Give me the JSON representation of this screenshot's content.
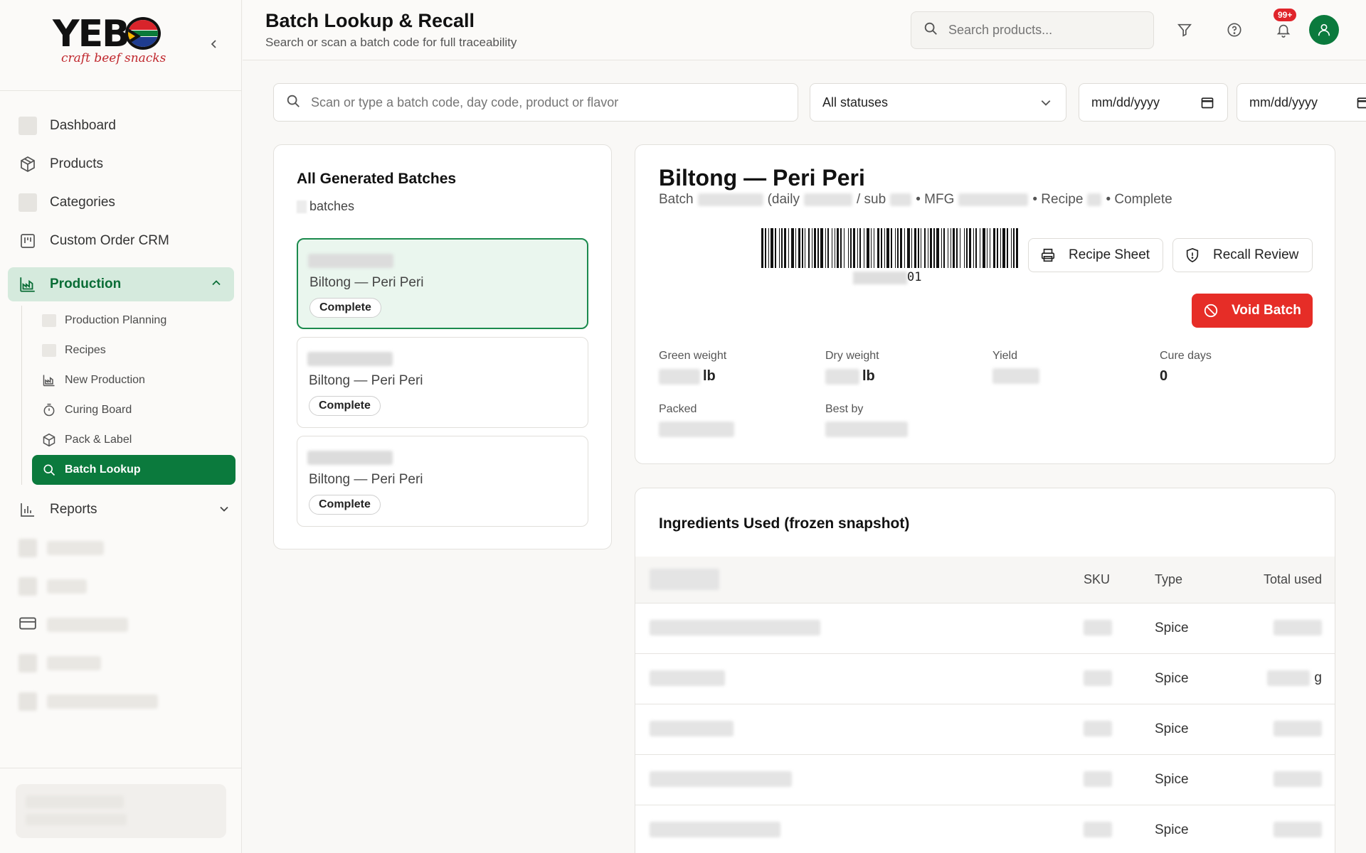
{
  "brand": {
    "logo_text": "YEBO",
    "tagline": "craft beef snacks"
  },
  "nav": {
    "items": [
      {
        "label": "Dashboard",
        "icon": "placeholder-icon"
      },
      {
        "label": "Products",
        "icon": "box-icon"
      },
      {
        "label": "Categories",
        "icon": "placeholder-icon"
      },
      {
        "label": "Custom Order CRM",
        "icon": "kanban-icon"
      }
    ],
    "production": {
      "label": "Production",
      "icon": "factory-icon",
      "expanded": true,
      "sub_items": [
        {
          "label": "Production Planning",
          "icon": "placeholder-icon"
        },
        {
          "label": "Recipes",
          "icon": "placeholder-icon"
        },
        {
          "label": "New Production",
          "icon": "factory-icon"
        },
        {
          "label": "Curing Board",
          "icon": "timer-icon"
        },
        {
          "label": "Pack & Label",
          "icon": "package-icon"
        },
        {
          "label": "Batch Lookup",
          "icon": "search-icon",
          "active": true
        }
      ]
    },
    "reports": {
      "label": "Reports",
      "icon": "bar-chart-icon"
    }
  },
  "header": {
    "title": "Batch Lookup & Recall",
    "subtitle": "Search or scan a batch code for full traceability",
    "search_placeholder": "Search products...",
    "notification_badge": "99+"
  },
  "filters": {
    "search_placeholder": "Scan or type a batch code, day code, product or flavor",
    "status_selected": "All statuses",
    "date_from_placeholder": "mm/dd/yyyy",
    "date_to_placeholder": "mm/dd/yyyy"
  },
  "batch_list": {
    "title": "All Generated Batches",
    "count_suffix": "batches",
    "items": [
      {
        "name": "Biltong — Peri Peri",
        "status": "Complete",
        "selected": true
      },
      {
        "name": "Biltong — Peri Peri",
        "status": "Complete",
        "selected": false
      },
      {
        "name": "Biltong — Peri Peri",
        "status": "Complete",
        "selected": false
      }
    ]
  },
  "detail": {
    "title": "Biltong — Peri Peri",
    "meta": {
      "batch": "Batch",
      "daily": "(daily",
      "sub": "/ sub",
      "mfg": "• MFG",
      "recipe": "• Recipe",
      "status": "• Complete"
    },
    "barcode_suffix": "01",
    "buttons": {
      "recipe_sheet": "Recipe Sheet",
      "recall_review": "Recall Review",
      "void_batch": "Void Batch"
    },
    "metrics": {
      "green_weight": {
        "label": "Green weight",
        "unit": "lb"
      },
      "dry_weight": {
        "label": "Dry weight",
        "unit": "lb"
      },
      "yield": {
        "label": "Yield"
      },
      "cure_days": {
        "label": "Cure days",
        "value": "0"
      },
      "packed": {
        "label": "Packed"
      },
      "best_by": {
        "label": "Best by"
      }
    }
  },
  "ingredients": {
    "title": "Ingredients Used (frozen snapshot)",
    "columns": {
      "sku": "SKU",
      "type": "Type",
      "total_used": "Total used"
    },
    "rows": [
      {
        "type": "Spice",
        "unit": ""
      },
      {
        "type": "Spice",
        "unit": "g"
      },
      {
        "type": "Spice",
        "unit": ""
      },
      {
        "type": "Spice",
        "unit": ""
      },
      {
        "type": "Spice",
        "unit": ""
      }
    ]
  },
  "colors": {
    "brand_green": "#0b7a3d",
    "active_bg": "#d5eadd",
    "danger": "#e62d27",
    "selected_card": "#eaf6ee"
  }
}
